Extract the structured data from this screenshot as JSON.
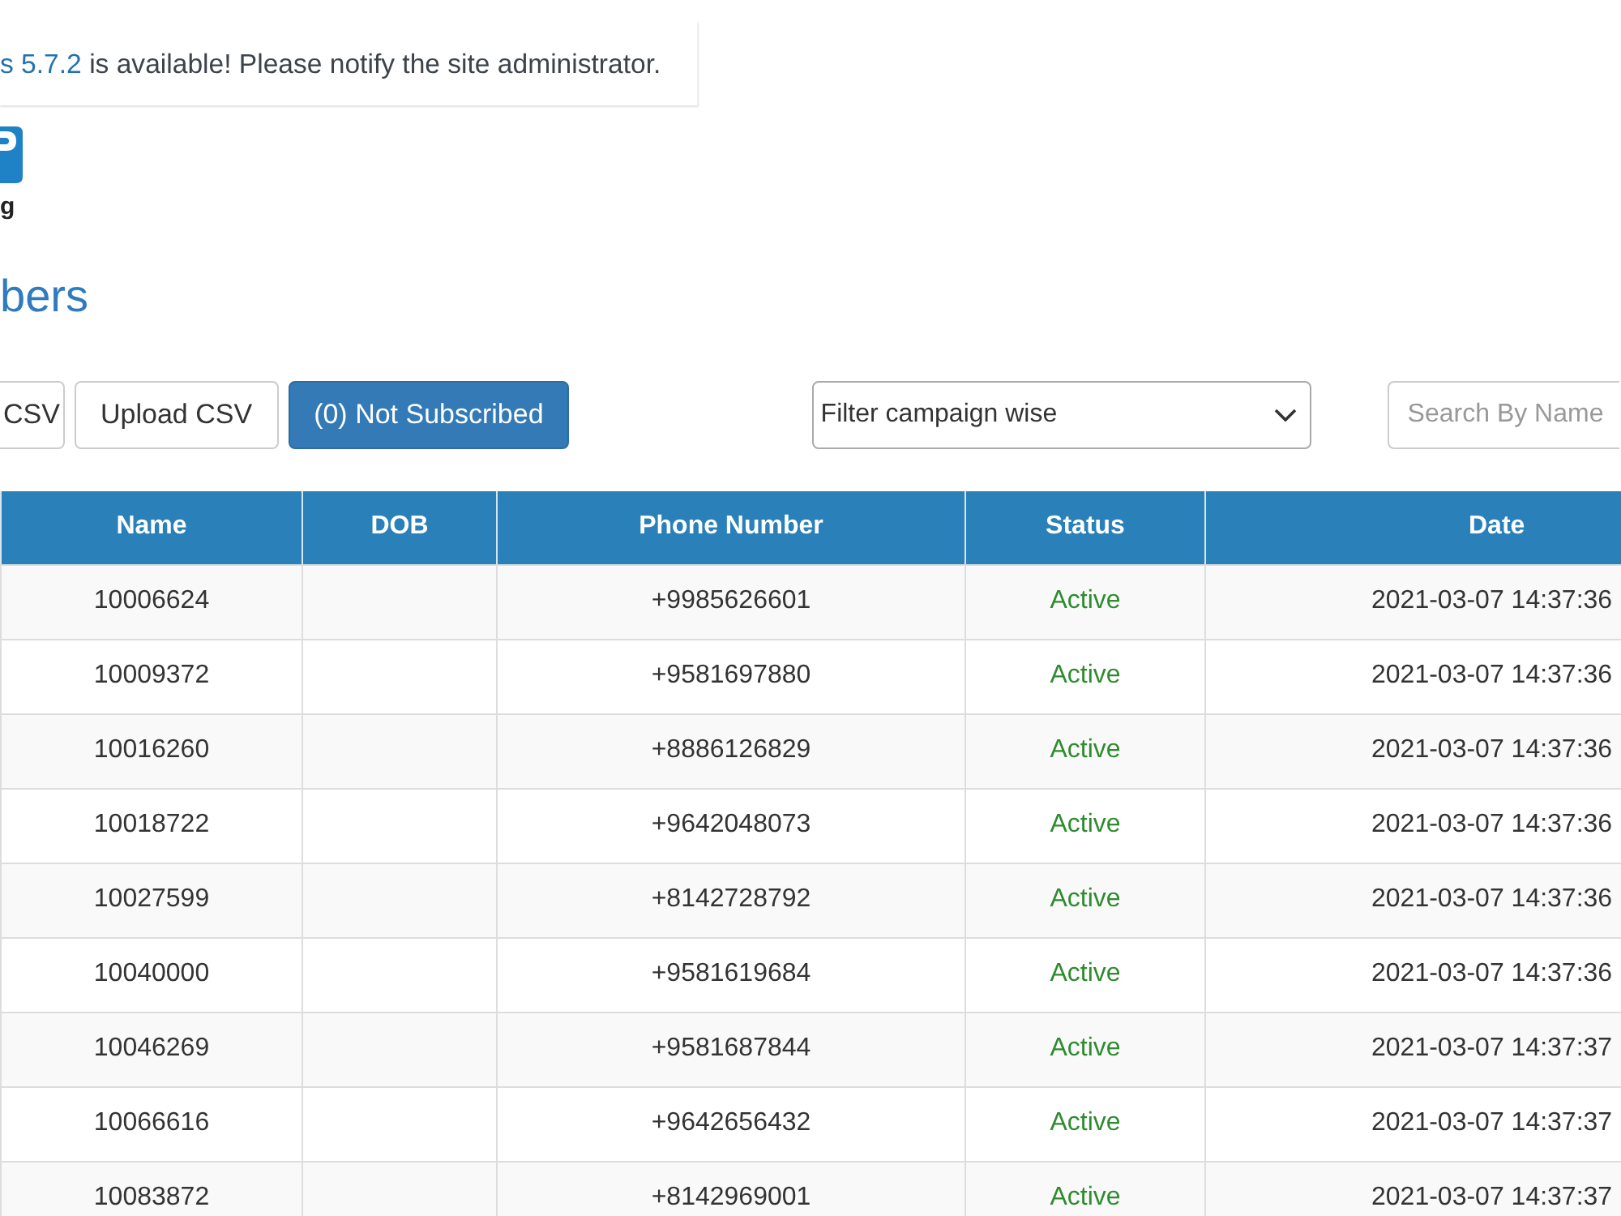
{
  "update_notice": {
    "link": "s 5.7.2",
    "message": "is available! Please notify the site administrator."
  },
  "logo": {
    "text": "g"
  },
  "page_title": "bers",
  "toolbar": {
    "buttons": [
      {
        "label": "CSV",
        "kind": "default"
      },
      {
        "label": "Upload CSV",
        "kind": "default"
      },
      {
        "label": "(0) Not Subscribed",
        "kind": "primary"
      }
    ],
    "filter_select": {
      "value": "Filter campaign wise"
    },
    "search": {
      "placeholder": "Search By Name"
    }
  },
  "table": {
    "columns": [
      "Name",
      "DOB",
      "Phone Number",
      "Status",
      "Date"
    ],
    "rows": [
      {
        "name": "10006624",
        "phone_number": "+9985626601",
        "status": "Active",
        "date": "2021-03-07 14:37:36"
      },
      {
        "name": "10009372",
        "phone_number": "+9581697880",
        "status": "Active",
        "date": "2021-03-07 14:37:36"
      },
      {
        "name": "10016260",
        "phone_number": "+8886126829",
        "status": "Active",
        "date": "2021-03-07 14:37:36"
      },
      {
        "name": "10018722",
        "phone_number": "+9642048073",
        "status": "Active",
        "date": "2021-03-07 14:37:36"
      },
      {
        "name": "10027599",
        "phone_number": "+8142728792",
        "status": "Active",
        "date": "2021-03-07 14:37:36"
      },
      {
        "name": "10040000",
        "phone_number": "+9581619684",
        "status": "Active",
        "date": "2021-03-07 14:37:36"
      },
      {
        "name": "10046269",
        "phone_number": "+9581687844",
        "status": "Active",
        "date": "2021-03-07 14:37:37"
      },
      {
        "name": "10066616",
        "phone_number": "+9642656432",
        "status": "Active",
        "date": "2021-03-07 14:37:37"
      },
      {
        "name": "10083872",
        "phone_number": "+8142969001",
        "status": "Active",
        "date": "2021-03-07 14:37:37"
      }
    ]
  }
}
